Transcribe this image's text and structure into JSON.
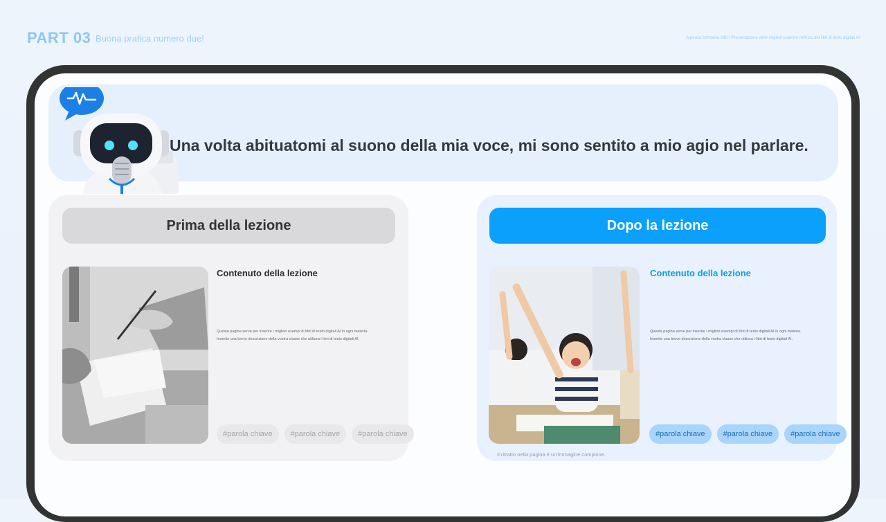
{
  "header": {
    "part_label": "PART 03",
    "subtitle": "Buona pratica numero due!",
    "right_text": "Agenzia formativa MBI | Presentazione delle migliori pratiche nell'uso dei libri di testo digitali AI"
  },
  "quote": {
    "text": "Una volta abituatomi al suono della mia voce, mi sono sentito a mio agio nel parlare."
  },
  "before": {
    "title": "Prima della lezione",
    "content_title": "Contenuto della lezione",
    "desc_line1": "Questa pagina serve per inserire i migliori esempi di libri di testo digitali AI in ogni materia.",
    "desc_line2": "Inserite una breve descrizione della vostra classe che utilizza i libri di testo digitali AI.",
    "tags": [
      "#parola chiave",
      "#parola chiave",
      "#parola chiave"
    ]
  },
  "after": {
    "title": "Dopo la lezione",
    "content_title": "Contenuto della lezione",
    "desc_line1": "Questa pagina serve per inserire i migliori esempi di libri di testo digitali AI in ogni materia.",
    "desc_line2": "Inserite una breve descrizione della vostra classe che utilizza i libri di testo digitali AI.",
    "tags": [
      "#parola chiave",
      "#parola chiave",
      "#parola chiave"
    ],
    "caption": "Il ritratto nella pagina è un'immagine campione."
  },
  "icons": [
    "robot-mascot-icon",
    "speech-bubble-waveform-icon",
    "microphone-icon"
  ],
  "colors": {
    "accent_blue": "#0ba0fb",
    "header_blue": "#8cc8f3",
    "device_frame": "#323433",
    "tag_blue": "#a9d4fb"
  }
}
